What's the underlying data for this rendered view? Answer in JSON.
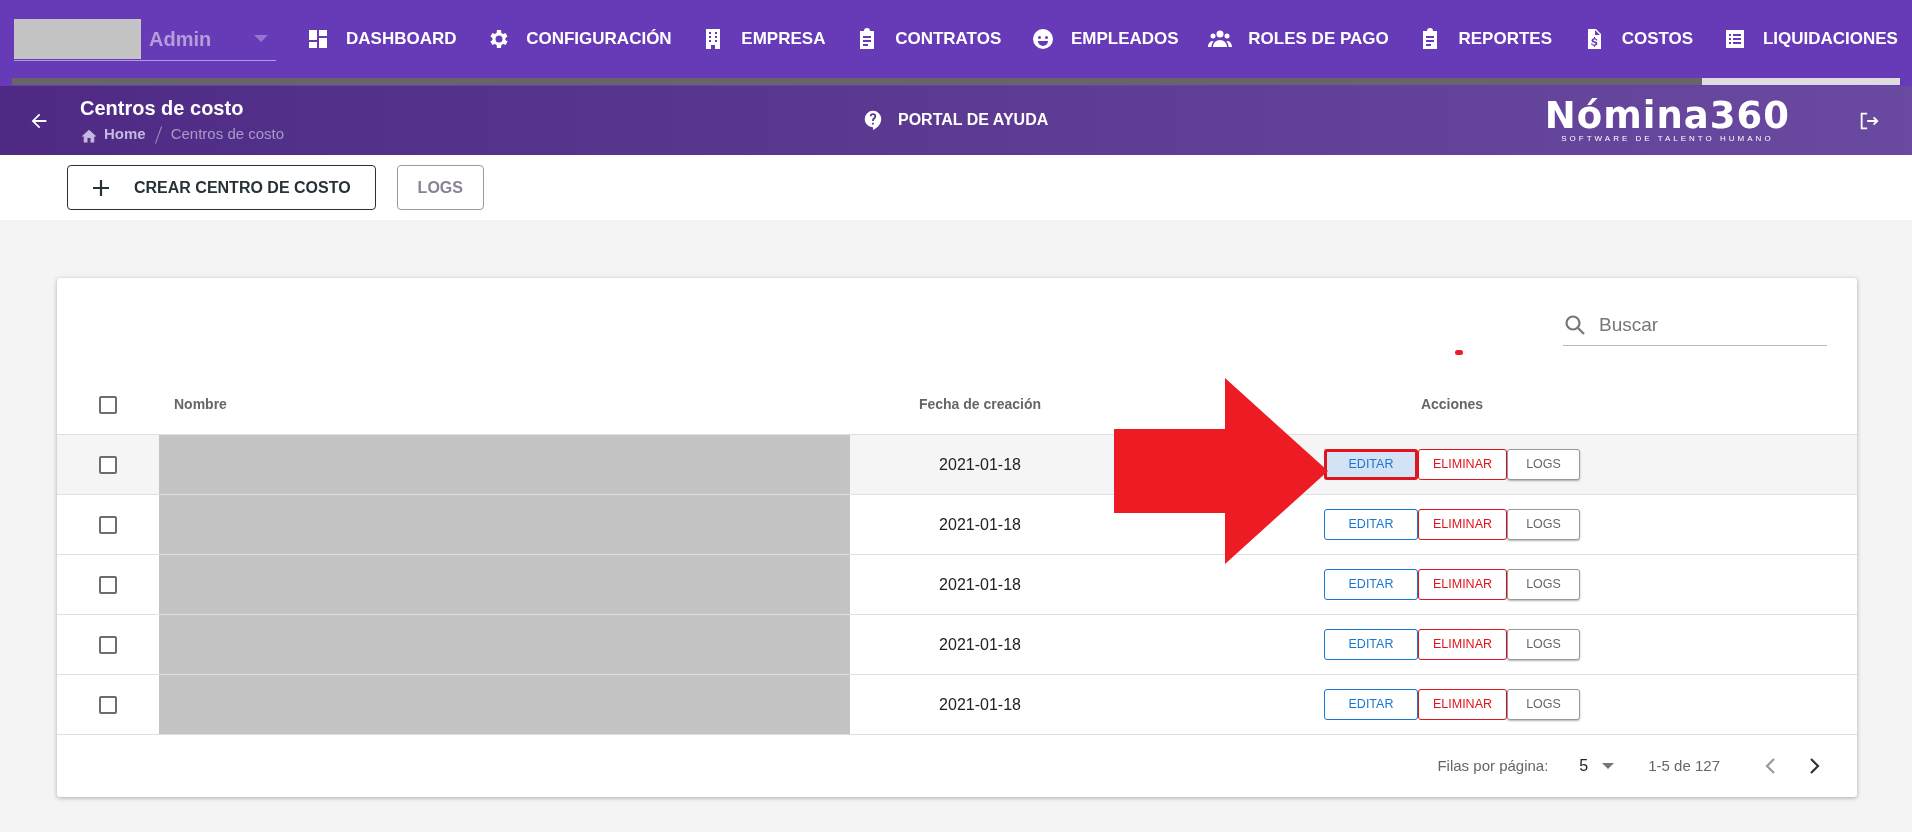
{
  "user_menu": {
    "label": "Admin"
  },
  "nav": [
    {
      "label": "DASHBOARD",
      "kind": "dashboard"
    },
    {
      "label": "CONFIGURACIÓN",
      "kind": "gear"
    },
    {
      "label": "EMPRESA",
      "kind": "building"
    },
    {
      "label": "CONTRATOS",
      "kind": "clipboard"
    },
    {
      "label": "EMPLEADOS",
      "kind": "face"
    },
    {
      "label": "ROLES DE PAGO",
      "kind": "people"
    },
    {
      "label": "REPORTES",
      "kind": "clipboard"
    },
    {
      "label": "COSTOS",
      "kind": "invoice"
    },
    {
      "label": "LIQUIDACIONES",
      "kind": "list"
    }
  ],
  "progress": {
    "level": 0.105
  },
  "header": {
    "title": "Centros de costo",
    "breadcrumbs": [
      "Home",
      "Centros de costo"
    ],
    "help": "PORTAL DE AYUDA",
    "logo": "Nómina360",
    "logo_tagline": "SOFTWARE DE TALENTO HUMANO"
  },
  "toolbar": {
    "create": "CREAR CENTRO DE COSTO",
    "logs": "LOGS"
  },
  "table": {
    "search": {
      "placeholder": "Buscar"
    },
    "header_checked": false,
    "columns": [
      "Nombre",
      "Fecha de creación",
      "Acciones"
    ],
    "rows": [
      {
        "checked": false,
        "highlighted": true,
        "date": "2021-01-18",
        "actions": [
          "EDITAR",
          "ELIMINAR",
          "LOGS"
        ]
      },
      {
        "checked": false,
        "highlighted": false,
        "date": "2021-01-18",
        "actions": [
          "EDITAR",
          "ELIMINAR",
          "LOGS"
        ]
      },
      {
        "checked": false,
        "highlighted": false,
        "date": "2021-01-18",
        "actions": [
          "EDITAR",
          "ELIMINAR",
          "LOGS"
        ]
      },
      {
        "checked": false,
        "highlighted": false,
        "date": "2021-01-18",
        "actions": [
          "EDITAR",
          "ELIMINAR",
          "LOGS"
        ]
      },
      {
        "checked": false,
        "highlighted": false,
        "date": "2021-01-18",
        "actions": [
          "EDITAR",
          "ELIMINAR",
          "LOGS"
        ]
      }
    ],
    "footer": {
      "rows_label": "Filas por página:",
      "rows_value": "5",
      "range": "1-5 de 127"
    }
  }
}
